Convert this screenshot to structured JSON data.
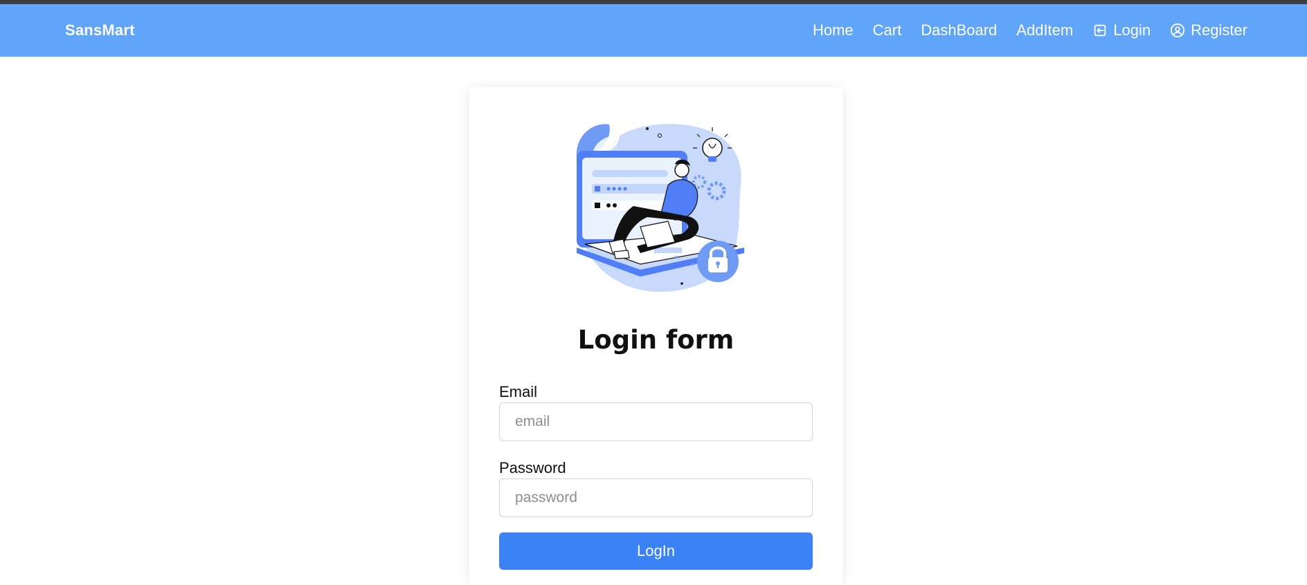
{
  "navbar": {
    "brand": "SansMart",
    "links": [
      {
        "label": "Home",
        "icon": null
      },
      {
        "label": "Cart",
        "icon": null
      },
      {
        "label": "DashBoard",
        "icon": null
      },
      {
        "label": "AddItem",
        "icon": null
      },
      {
        "label": "Login",
        "icon": "login-icon"
      },
      {
        "label": "Register",
        "icon": "user-circle-icon"
      }
    ]
  },
  "form": {
    "title": "Login form",
    "email": {
      "label": "Email",
      "placeholder": "email",
      "value": ""
    },
    "password": {
      "label": "Password",
      "placeholder": "password",
      "value": ""
    },
    "submit_label": "LogIn"
  },
  "colors": {
    "navbar_bg": "#60a5fa",
    "primary_button": "#3b82f6",
    "illustration_accent": "#4f7ef7"
  }
}
